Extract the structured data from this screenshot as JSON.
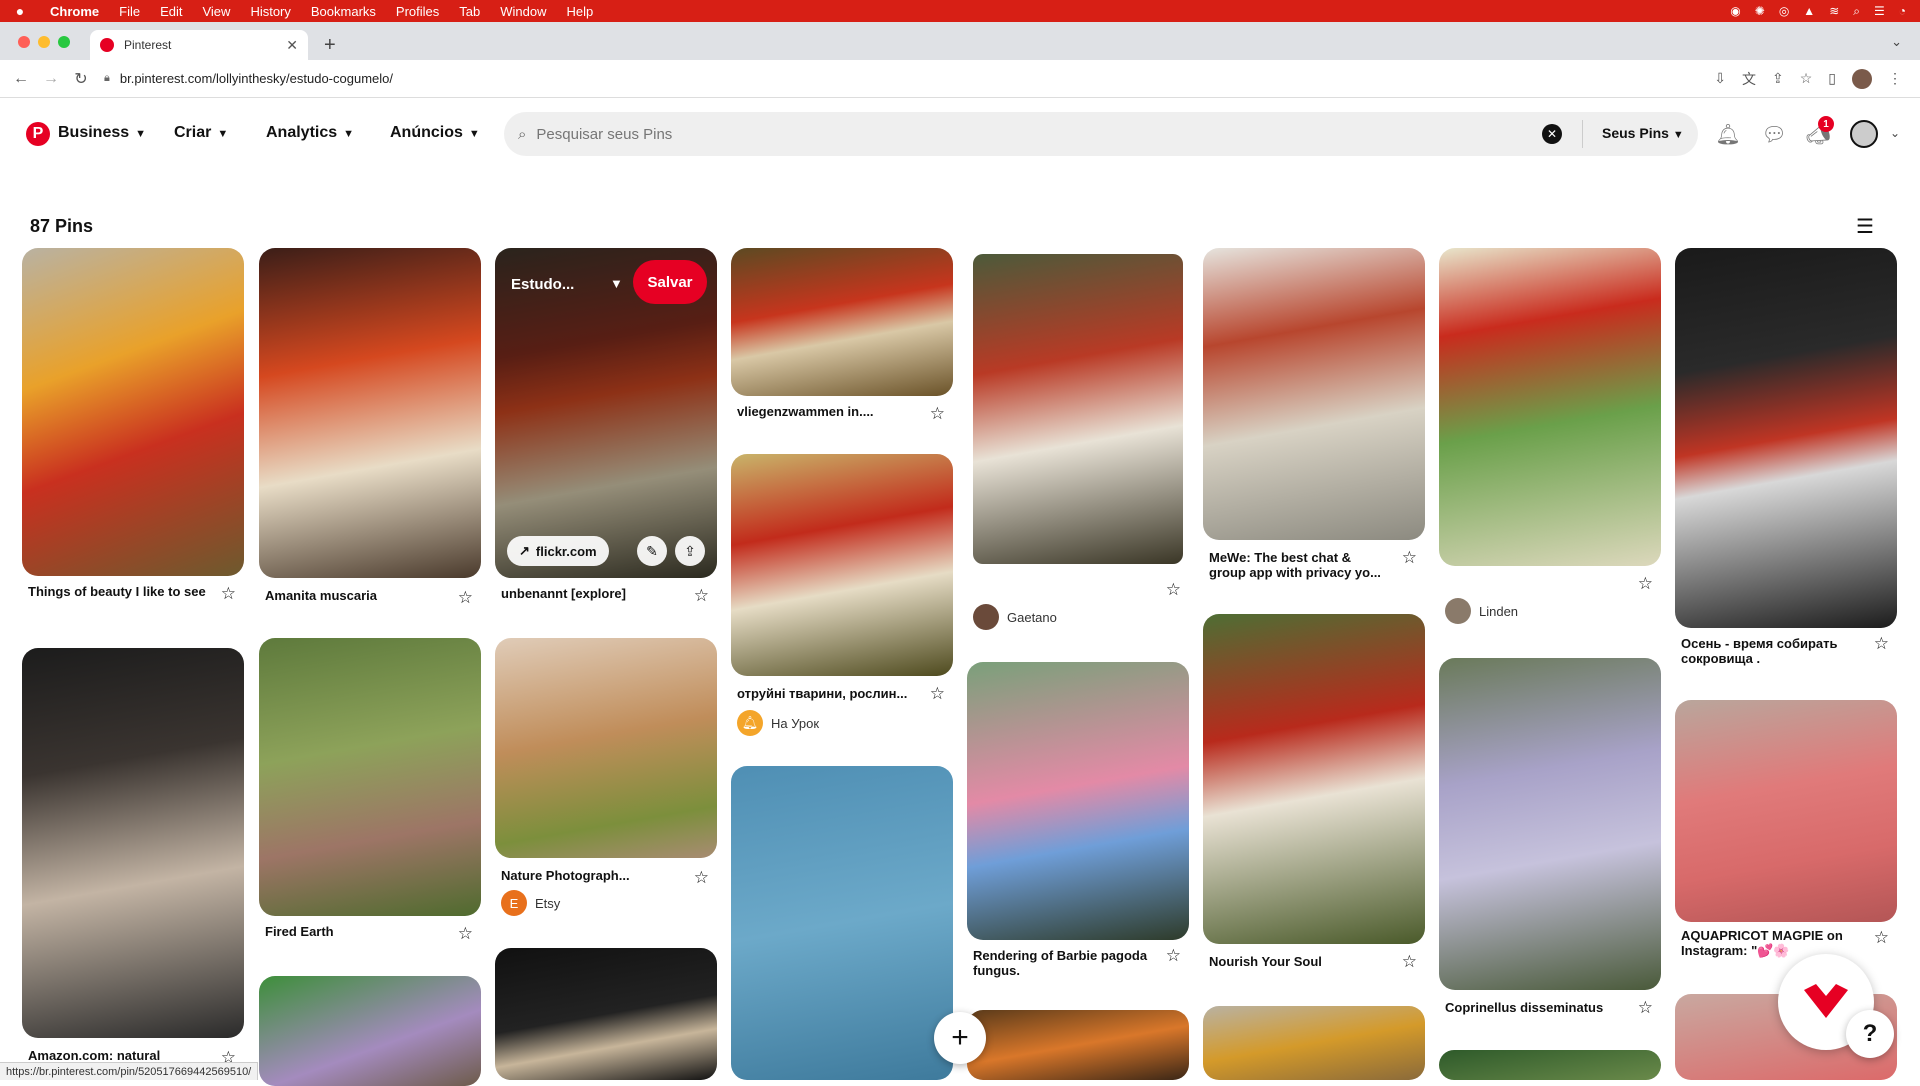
{
  "menubar": {
    "app": "Chrome",
    "items": [
      "File",
      "Edit",
      "View",
      "History",
      "Bookmarks",
      "Profiles",
      "Tab",
      "Window",
      "Help"
    ]
  },
  "browser": {
    "tab_title": "Pinterest",
    "url": "br.pinterest.com/lollyinthesky/estudo-cogumelo/",
    "status_url": "https://br.pinterest.com/pin/520517669442569510/"
  },
  "header": {
    "nav": [
      "Business",
      "Criar",
      "Analytics",
      "Anúncios"
    ],
    "search_placeholder": "Pesquisar seus Pins",
    "scope": "Seus Pins",
    "notification_count": "1"
  },
  "board": {
    "pin_count": "87 Pins"
  },
  "hover_pin": {
    "board_name": "Estudo...",
    "save_label": "Salvar",
    "source": "flickr.com"
  },
  "pins": [
    {
      "title": "Things of beauty I like to see"
    },
    {
      "title": "Amanita muscaria"
    },
    {
      "title": "unbenannt [explore]"
    },
    {
      "title": "vliegenzwammen in...."
    },
    {
      "title": "отруйні тварини, рослин...",
      "author": "На Урок"
    },
    {
      "author": "Gaetano"
    },
    {
      "title": "MeWe: The best chat & group app with privacy yo..."
    },
    {
      "author": "Linden"
    },
    {
      "title": "Осень - время собирать сокровища ."
    },
    {
      "title": "Amazon.com: natural"
    },
    {
      "title": "Fired Earth"
    },
    {
      "title": "Nature Photograph...",
      "author": "Etsy"
    },
    {
      "title": "Rendering of Barbie pagoda fungus."
    },
    {
      "title": "Nourish Your Soul"
    },
    {
      "title": "Coprinellus disseminatus"
    },
    {
      "title": "AQUAPRICOT MAGPIE on Instagram: \"💕🌸"
    }
  ],
  "colors": {
    "brand": "#e60023",
    "menubar": "#d71f15"
  }
}
